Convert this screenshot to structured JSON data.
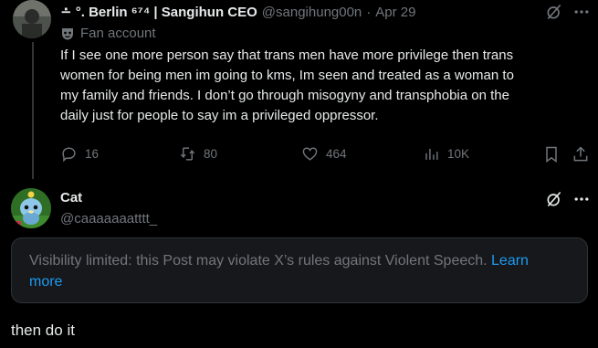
{
  "tweet1": {
    "display_name": "∸ °. Berlin ⁶⁷⁴ | Sangihun CEO",
    "handle": "@sangihung00n",
    "separator": "·",
    "date": "Apr 29",
    "label": "Fan account",
    "text_lines": [
      "If I see one more person say that trans men have more privilege then trans",
      "women for being men im going to kms, Im seen and treated as a woman to",
      "my family and friends. I don’t go through misogyny and transphobia on the",
      "daily just for people to say im a privileged oppressor."
    ],
    "replies": "16",
    "reposts": "80",
    "likes": "464",
    "views": "10K"
  },
  "tweet2": {
    "display_name": "Cat",
    "handle": "@caaaaaaatttt_",
    "notice_text": "Visibility limited: this Post may violate X’s rules against Violent Speech.",
    "notice_link_1": "Learn",
    "notice_link_2": "more",
    "reply_text": "then do it"
  },
  "colors": {
    "background": "#000000",
    "text": "#e7e9ea",
    "muted": "#71767b",
    "link": "#1d9bf0",
    "thread_line": "#333639"
  }
}
